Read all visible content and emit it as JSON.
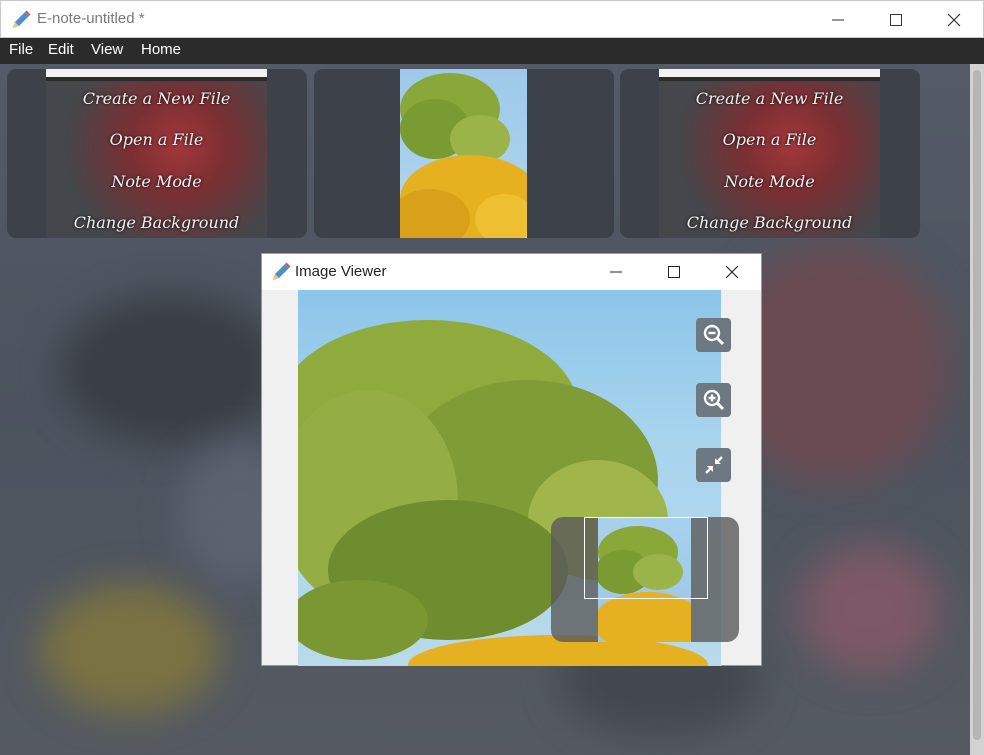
{
  "window": {
    "title": "E-note-untitled *"
  },
  "menubar": {
    "items": [
      "File",
      "Edit",
      "View",
      "Home"
    ]
  },
  "thumbnails": [
    {
      "menu": [
        "Create a New File",
        "Open a File",
        "Note Mode",
        "Change Background"
      ]
    },
    {
      "kind": "tree-photo"
    },
    {
      "menu": [
        "Create a New File",
        "Open a File",
        "Note Mode",
        "Change Background"
      ]
    }
  ],
  "viewer": {
    "title": "Image Viewer",
    "tools": [
      "zoom-out-icon",
      "zoom-in-icon",
      "fit-icon"
    ]
  },
  "colors": {
    "menubar": "#2b2b2b",
    "tool": "#6d7882",
    "sky": "#9ecbea",
    "foliage": "#8aa83a",
    "autumn": "#e5b121"
  }
}
